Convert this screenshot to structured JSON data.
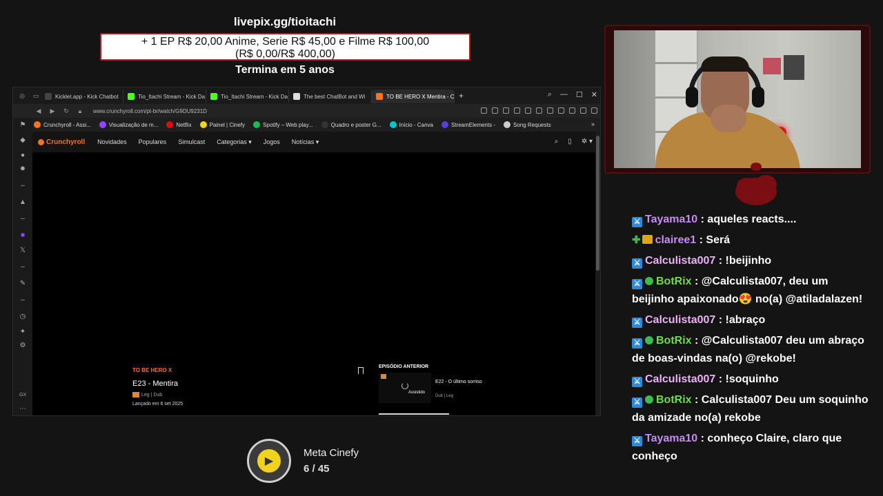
{
  "overlay": {
    "livepix_url": "livepix.gg/tioitachi",
    "goal_line1": "+ 1 EP R$ 20,00 Anime, Serie R$ 45,00 e Filme R$ 100,00",
    "goal_line2": "(R$ 0,00/R$ 400,00)",
    "ends": "Termina em 5 anos"
  },
  "browser": {
    "tabs": [
      {
        "label": "Kicklet.app - Kick Chatbot",
        "color": "#444444"
      },
      {
        "label": "Tio_Itachi Stream - Kick Da",
        "color": "#53fc18"
      },
      {
        "label": "Tio_Itachi Stream - Kick Da",
        "color": "#53fc18"
      },
      {
        "label": "The best ChatBot and Wi",
        "color": "#dddddd"
      },
      {
        "label": "TO BE HERO X Mentira - C",
        "color": "#f47521",
        "active": true
      }
    ],
    "url": "www.crunchyroll.com/pt-br/watch/G9DU9231D",
    "bookmarks": [
      {
        "label": "Crunchyroll - Assi...",
        "color": "#f47521"
      },
      {
        "label": "Visualização de m...",
        "color": "#9146ff"
      },
      {
        "label": "Netflix",
        "color": "#e50914"
      },
      {
        "label": "Painel | Cinefy",
        "color": "#f1d21e"
      },
      {
        "label": "Spotify – Web play...",
        "color": "#1db954"
      },
      {
        "label": "Quadro e poster G...",
        "color": "#333333"
      },
      {
        "label": "Início - Canva",
        "color": "#00c4cc"
      },
      {
        "label": "StreamElements -",
        "color": "#5a3fd8"
      },
      {
        "label": "Song Requests",
        "color": "#cccccc"
      }
    ]
  },
  "crunchyroll": {
    "logo": "Crunchyroll",
    "nav": [
      "Novidades",
      "Populares",
      "Simulcast",
      "Categorias ▾",
      "Jogos",
      "Notícias ▾"
    ],
    "show": "TO BE HERO X",
    "episode": "E23 - Mentira",
    "meta": "Leg | Dub",
    "date": "Lançado em 6 set 2025",
    "prev_label": "EPISÓDIO ANTERIOR",
    "prev_title": "E22 - O último sorriso",
    "prev_watched": "Assistido",
    "prev_meta": "Dub | Leg"
  },
  "chat": [
    {
      "badges": [
        "mod"
      ],
      "user": "Tayama10",
      "color": "purple",
      "text": ": aqueles reacts...."
    },
    {
      "badges": [
        "sub",
        "crown"
      ],
      "user": "clairee1",
      "color": "purple",
      "text": ": Será"
    },
    {
      "badges": [
        "mod"
      ],
      "user": "Calculista007",
      "color": "pink",
      "text": ": !beijinho"
    },
    {
      "badges": [
        "mod",
        "verified"
      ],
      "user": "BotRix",
      "color": "green",
      "text": ": @Calculista007, deu um beijinho apaixonado😍 no(a) @atiladalazen!"
    },
    {
      "badges": [
        "mod"
      ],
      "user": "Calculista007",
      "color": "pink",
      "text": ": !abraço"
    },
    {
      "badges": [
        "mod",
        "verified"
      ],
      "user": "BotRix",
      "color": "green",
      "text": ": @Calculista007 deu um abraço de boas-vindas na(o) @rekobe!"
    },
    {
      "badges": [
        "mod"
      ],
      "user": "Calculista007",
      "color": "pink",
      "text": ": !soquinho"
    },
    {
      "badges": [
        "mod",
        "verified"
      ],
      "user": "BotRix",
      "color": "green",
      "text": ": Calculista007 Deu um soquinho da amizade no(a) rekobe"
    },
    {
      "badges": [
        "mod"
      ],
      "user": "Tayama10",
      "color": "purple",
      "text": ": conheço Claire, claro que conheço"
    }
  ],
  "meta": {
    "title": "Meta Cinefy",
    "count": "6 / 45"
  }
}
